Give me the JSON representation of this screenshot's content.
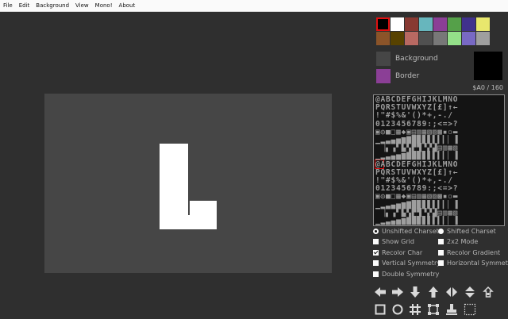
{
  "menu": [
    "File",
    "Edit",
    "Background",
    "View",
    "Mono!",
    "About"
  ],
  "palette": [
    "#000000",
    "#ffffff",
    "#883932",
    "#67b6bd",
    "#8b3f96",
    "#55a049",
    "#40318d",
    "#e8e76d",
    "#8b5429",
    "#574200",
    "#b86962",
    "#505050",
    "#787878",
    "#94e089",
    "#7869c4",
    "#9f9f9f"
  ],
  "selected_palette_index": 0,
  "background": {
    "label": "Background",
    "color": "#464646"
  },
  "border": {
    "label": "Border",
    "color": "#8b3f96"
  },
  "preview_color": "#000000",
  "char_code": "$A0 / 160",
  "charset_rows": [
    "@ABCDEFGHIJKLMNO",
    "PQRSTUVWXYZ[£]↑←",
    " !\"#$%&'()*+,-./",
    "0123456789:;<=>?",
    "▣◎■□▦◆▣▤▥▦▧▨▩▪▫▬",
    "▁▂▃▄▅▆▇█▉▊▋▌▍▎▏▐",
    "▔▕▖▗▘▙▚▛▜▝▞▟▤▥▦▧",
    "▁▂▃▄▅▆▇█▉▊▋▌▍▎▏▐",
    "@ABCDEFGHIJKLMNO",
    "PQRSTUVWXYZ[£]↑←",
    " !\"#$%&'()*+,-./",
    "0123456789:;<=>?",
    "▣◎■□▦◆▣▤▥▦▧▨▩▪▫▬",
    "▁▂▃▄▅▆▇█▉▊▋▌▍▎▏▐",
    "▔▕▖▗▘▙▚▛▜▝▞▟▤▥▦▧",
    "▁▂▃▄▅▆▇█▉▊▋▌▍▎▏▐"
  ],
  "options": {
    "unshifted": {
      "label": "Unshifted Charset",
      "checked": true
    },
    "shifted": {
      "label": "Shifted Charset",
      "checked": false
    },
    "show_grid": {
      "label": "Show Grid",
      "checked": false
    },
    "mode_2x2": {
      "label": "2x2 Mode",
      "checked": false
    },
    "recolor_char": {
      "label": "Recolor Char",
      "checked": true
    },
    "recolor_gradient": {
      "label": "Recolor Gradient",
      "checked": false
    },
    "vertical_symmetry": {
      "label": "Vertical Symmetry",
      "checked": false
    },
    "horizontal_symmetry": {
      "label": "Horizontal Symmetry",
      "checked": false
    },
    "double_symmetry": {
      "label": "Double Symmetry",
      "checked": false
    }
  },
  "tools_row1": [
    "arrow-left-icon",
    "arrow-right-icon",
    "arrow-down-icon",
    "arrow-up-icon",
    "flip-horizontal-icon",
    "flip-vertical-icon",
    "invert-icon"
  ],
  "tools_row2": [
    "rectangle-icon",
    "circle-icon",
    "grid-icon",
    "select-icon",
    "stamp-icon",
    "dotted-select-icon"
  ]
}
